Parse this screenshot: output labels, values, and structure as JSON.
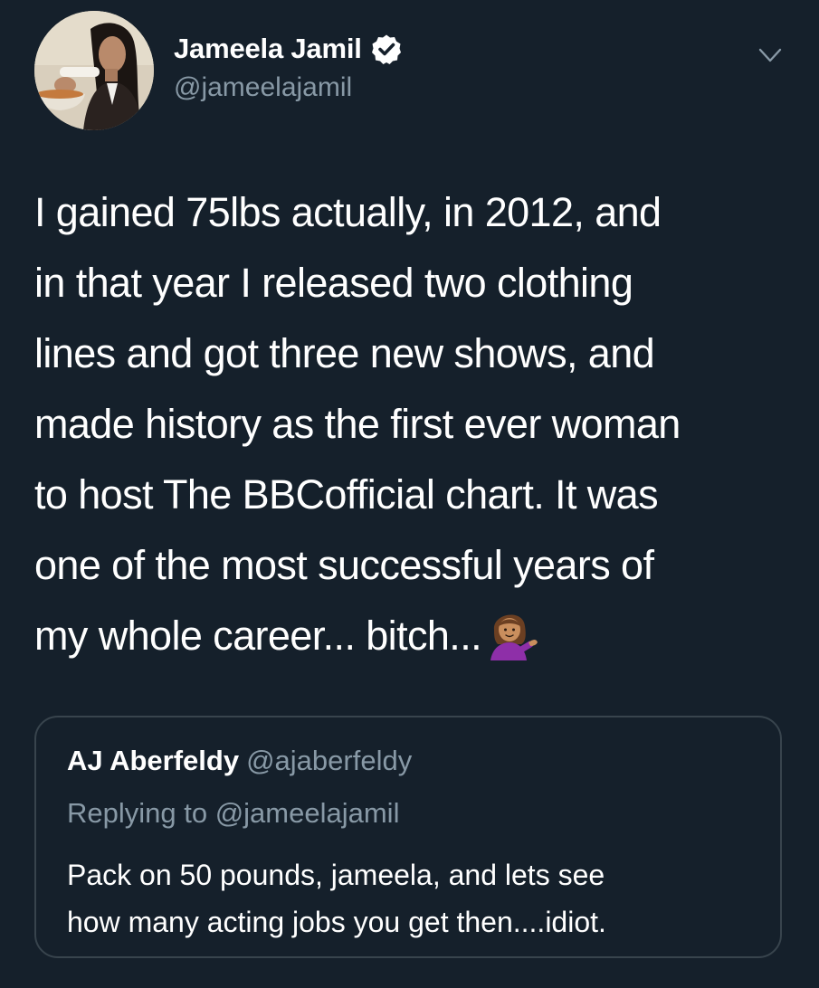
{
  "author": {
    "display_name": "Jameela Jamil",
    "handle": "@jameelajamil",
    "verified": true,
    "avatar_icon": "profile-photo"
  },
  "tweet": {
    "lines": [
      "I gained 75lbs actually, in 2012, and",
      "in that year I released two clothing",
      "lines and got three new shows, and",
      "made history as the first ever woman",
      "to host The BBCofficial chart. It was",
      "one of the most successful years of",
      "my whole career... bitch..."
    ],
    "emoji_icon": "person-tipping-hand-emoji"
  },
  "quote": {
    "display_name": "AJ Aberfeldy",
    "handle": "@ajaberfeldy",
    "replying_to": "Replying to @jameelajamil",
    "lines": [
      "Pack on 50 pounds, jameela, and lets see",
      "how many acting jobs you get then....idiot."
    ]
  },
  "menu_icon": "chevron-down-icon",
  "colors": {
    "background": "#15202b",
    "primary_text": "#ffffff",
    "secondary_text": "#8899a6",
    "border": "#38444d"
  }
}
